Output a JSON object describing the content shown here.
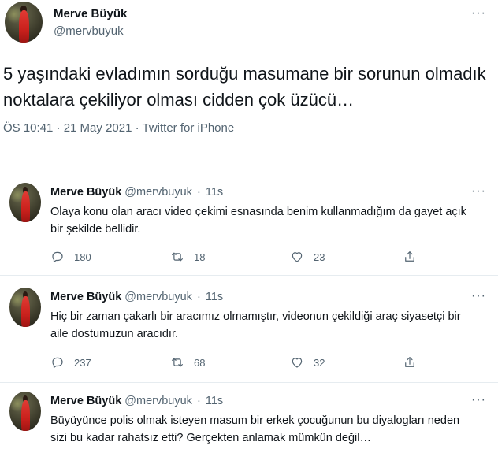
{
  "main_tweet": {
    "author_name": "Merve Büyük",
    "author_handle": "@mervbuyuk",
    "text": "5 yaşındaki evladımın sorduğu masumane bir sorunun olmadık noktalara çekiliyor olması cidden çok üzücü…",
    "meta": "ÖS 10:41 · 21 May 2021 · Twitter for iPhone",
    "more_label": "···"
  },
  "replies": [
    {
      "author_name": "Merve Büyük",
      "author_handle": "@mervbuyuk",
      "time": "11s",
      "text": "Olaya konu olan aracı video çekimi esnasında benim kullanmadığım da gayet açık bir şekilde bellidir.",
      "reply_count": "180",
      "retweet_count": "18",
      "like_count": "23"
    },
    {
      "author_name": "Merve Büyük",
      "author_handle": "@mervbuyuk",
      "time": "11s",
      "text": "Hiç bir zaman çakarlı bir aracımız olmamıştır, videonun çekildiği araç siyasetçi bir aile dostumuzun aracıdır.",
      "reply_count": "237",
      "retweet_count": "68",
      "like_count": "32"
    },
    {
      "author_name": "Merve Büyük",
      "author_handle": "@mervbuyuk",
      "time": "11s",
      "text": "Büyüyünce polis olmak isteyen masum bir erkek çocuğunun bu diyalogları neden sizi bu kadar rahatsız etti? Gerçekten anlamak mümkün değil…"
    }
  ],
  "icons": {
    "reply": "reply-icon",
    "retweet": "retweet-icon",
    "like": "heart-icon",
    "share": "share-icon",
    "more": "more-icon"
  },
  "colors": {
    "text": "#0f1419",
    "muted": "#536471",
    "divider": "#e6ecf0",
    "avatar_dress": "#c8201c"
  }
}
